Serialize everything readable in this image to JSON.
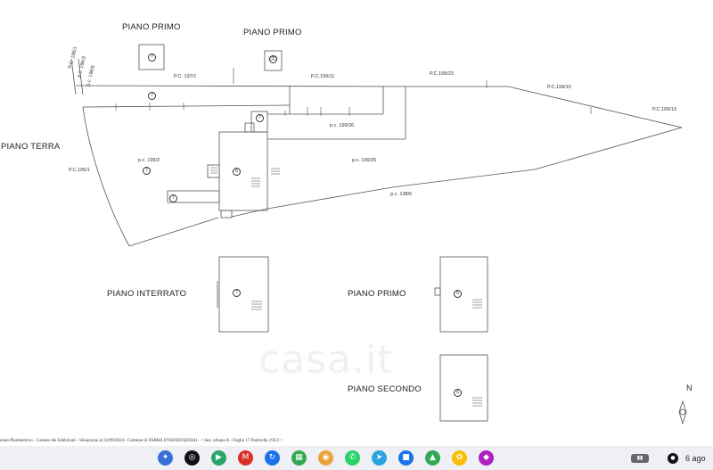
{
  "labels": {
    "piano_primo_1": "PIANO PRIMO",
    "piano_primo_2": "PIANO PRIMO",
    "piano_terra": "PIANO TERRA",
    "piano_interrato": "PIANO INTERRATO",
    "piano_primo_3": "PIANO PRIMO",
    "piano_secondo": "PIANO SECONDO"
  },
  "parcels": {
    "pc_196_1": "P.C. 196/1",
    "pc_196_3": "p.c. 196/3",
    "pc_196_5": "p.c. 196/5",
    "pc_197_1": "P.C. 197/1",
    "pc_199_11": "P.C.199/11",
    "pc_199_23": "P.C.199/23",
    "pc_199_10": "P.C.199/10",
    "pc_199_13": "P.C.199/13",
    "pc_199_26": "p.c. 199/26",
    "pc_195_1": "P.C.195/1",
    "pc_195_2": "p.c. 195/2",
    "pc_199_25": "p.c. 199/25",
    "pc_198_6": "p.c. 198/6"
  },
  "markers": {
    "seven": "7",
    "six": "6"
  },
  "footer": "erato Planimetrico - Catasto dei Fabbricati - Situazione al 22/09/2024 - Comune di FARRA D'ISONZO(D504) - < Sez. urbana A - Foglio 17 Particella 195/2 >",
  "watermark": "casa.it",
  "north": "N",
  "taskbar": {
    "date": "6 ago",
    "icons": [
      {
        "name": "assistant-icon",
        "glyph": "✦",
        "color": "#3b6fd8"
      },
      {
        "name": "podcast-icon",
        "glyph": "◎",
        "color": "#111111"
      },
      {
        "name": "play-store-icon",
        "glyph": "▶",
        "color": "#2aa56a"
      },
      {
        "name": "gmail-icon",
        "glyph": "M",
        "color": "#d93025"
      },
      {
        "name": "sync-icon",
        "glyph": "↻",
        "color": "#1a73e8"
      },
      {
        "name": "apps-icon",
        "glyph": "▦",
        "color": "#34a853"
      },
      {
        "name": "chrome-icon",
        "glyph": "◉",
        "color": "#e8a33b"
      },
      {
        "name": "whatsapp-icon",
        "glyph": "✆",
        "color": "#25d366"
      },
      {
        "name": "telegram-icon",
        "glyph": "➤",
        "color": "#2aa3de"
      },
      {
        "name": "files-icon",
        "glyph": "■",
        "color": "#1a73e8"
      },
      {
        "name": "drive-icon",
        "glyph": "▲",
        "color": "#34a853"
      },
      {
        "name": "photos-icon",
        "glyph": "✿",
        "color": "#fbbc04"
      },
      {
        "name": "app-icon",
        "glyph": "◆",
        "color": "#b01fbf"
      }
    ]
  }
}
